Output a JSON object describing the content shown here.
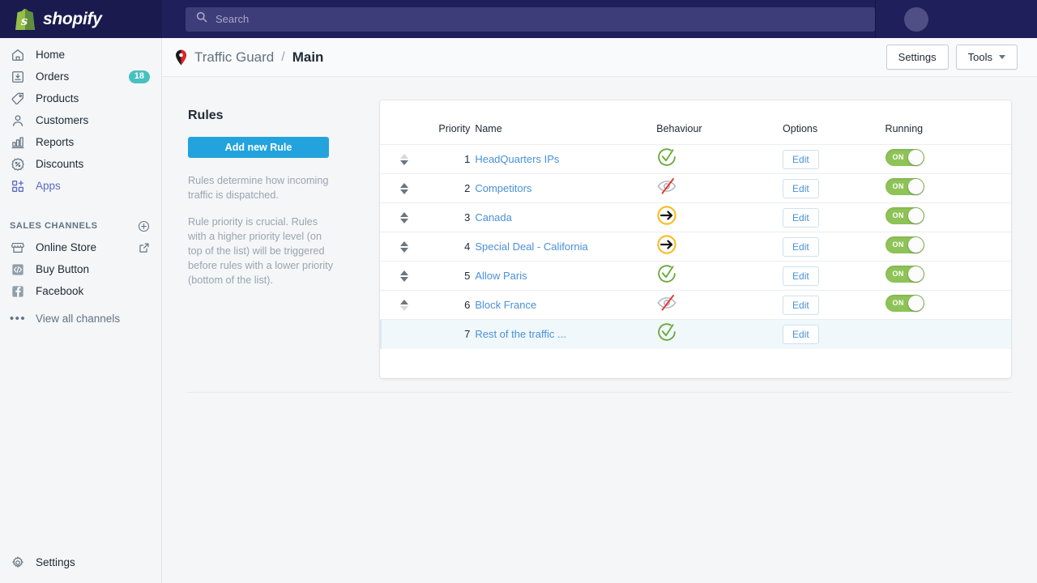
{
  "topbar": {
    "brand": "shopify",
    "search_placeholder": "Search",
    "avatar_name": "user-avatar"
  },
  "sidebar": {
    "items": [
      {
        "label": "Home",
        "icon": "home-icon",
        "badge": null,
        "active": false
      },
      {
        "label": "Orders",
        "icon": "orders-icon",
        "badge": "18",
        "active": false
      },
      {
        "label": "Products",
        "icon": "products-icon",
        "badge": null,
        "active": false
      },
      {
        "label": "Customers",
        "icon": "customers-icon",
        "badge": null,
        "active": false
      },
      {
        "label": "Reports",
        "icon": "reports-icon",
        "badge": null,
        "active": false
      },
      {
        "label": "Discounts",
        "icon": "discounts-icon",
        "badge": null,
        "active": false
      },
      {
        "label": "Apps",
        "icon": "apps-icon",
        "badge": null,
        "active": true
      }
    ],
    "section_title": "SALES CHANNELS",
    "add_channel_icon": "plus-circle-icon",
    "channels": [
      {
        "label": "Online Store",
        "icon": "storefront-icon",
        "trailing": "external-link-icon"
      },
      {
        "label": "Buy Button",
        "icon": "code-icon",
        "trailing": null
      },
      {
        "label": "Facebook",
        "icon": "facebook-icon",
        "trailing": null
      }
    ],
    "view_all_label": "View all channels",
    "settings_label": "Settings"
  },
  "header": {
    "pin_icon": "map-pin-icon",
    "breadcrumb_app": "Traffic Guard",
    "breadcrumb_sep": "/",
    "breadcrumb_page": "Main",
    "settings_button": "Settings",
    "tools_button": "Tools"
  },
  "rules_panel": {
    "title": "Rules",
    "add_button": "Add new Rule",
    "paragraph1": "Rules determine how incoming traffic is dispatched.",
    "paragraph2": "Rule priority is crucial. Rules with a higher priority level (on top of the list) will be triggered before rules with a lower priority (bottom of the list)."
  },
  "table": {
    "columns": [
      "",
      "Priority",
      "Name",
      "Behaviour",
      "Options",
      "Running"
    ],
    "edit_label": "Edit",
    "toggle_on_label": "ON",
    "rows": [
      {
        "priority": "1",
        "name": "HeadQuarters IPs",
        "behaviour": "allow-icon",
        "edit": true,
        "running": "ON",
        "up_enabled": false,
        "down_enabled": true,
        "highlight": false
      },
      {
        "priority": "2",
        "name": "Competitors",
        "behaviour": "block-icon",
        "edit": true,
        "running": "ON",
        "up_enabled": true,
        "down_enabled": true,
        "highlight": false
      },
      {
        "priority": "3",
        "name": "Canada",
        "behaviour": "redirect-icon",
        "edit": true,
        "running": "ON",
        "up_enabled": true,
        "down_enabled": true,
        "highlight": false
      },
      {
        "priority": "4",
        "name": "Special Deal - California",
        "behaviour": "redirect-icon",
        "edit": true,
        "running": "ON",
        "up_enabled": true,
        "down_enabled": true,
        "highlight": false
      },
      {
        "priority": "5",
        "name": "Allow Paris",
        "behaviour": "allow-icon",
        "edit": true,
        "running": "ON",
        "up_enabled": true,
        "down_enabled": true,
        "highlight": false
      },
      {
        "priority": "6",
        "name": "Block France",
        "behaviour": "block-icon",
        "edit": true,
        "running": "ON",
        "up_enabled": true,
        "down_enabled": false,
        "highlight": false
      },
      {
        "priority": "7",
        "name": "Rest of the traffic ...",
        "behaviour": "allow-icon",
        "edit": true,
        "running": null,
        "up_enabled": null,
        "down_enabled": null,
        "highlight": true
      }
    ]
  },
  "colors": {
    "topbar": "#1f1f5c",
    "topbar_logo": "#1a1a4e",
    "search_field": "#3d3d7a",
    "sidebar_bg": "#f4f6f8",
    "accent_active": "#5c6ac4",
    "badge_teal": "#47c1bf",
    "add_button_blue": "#23a3dd",
    "link_blue": "#4a90d9",
    "toggle_green": "#8ec358",
    "allow_green": "#6aa83a",
    "block_red": "#e8342a",
    "redirect_yellow": "#f5bf2a",
    "row_highlight": "#f0f8fc"
  }
}
